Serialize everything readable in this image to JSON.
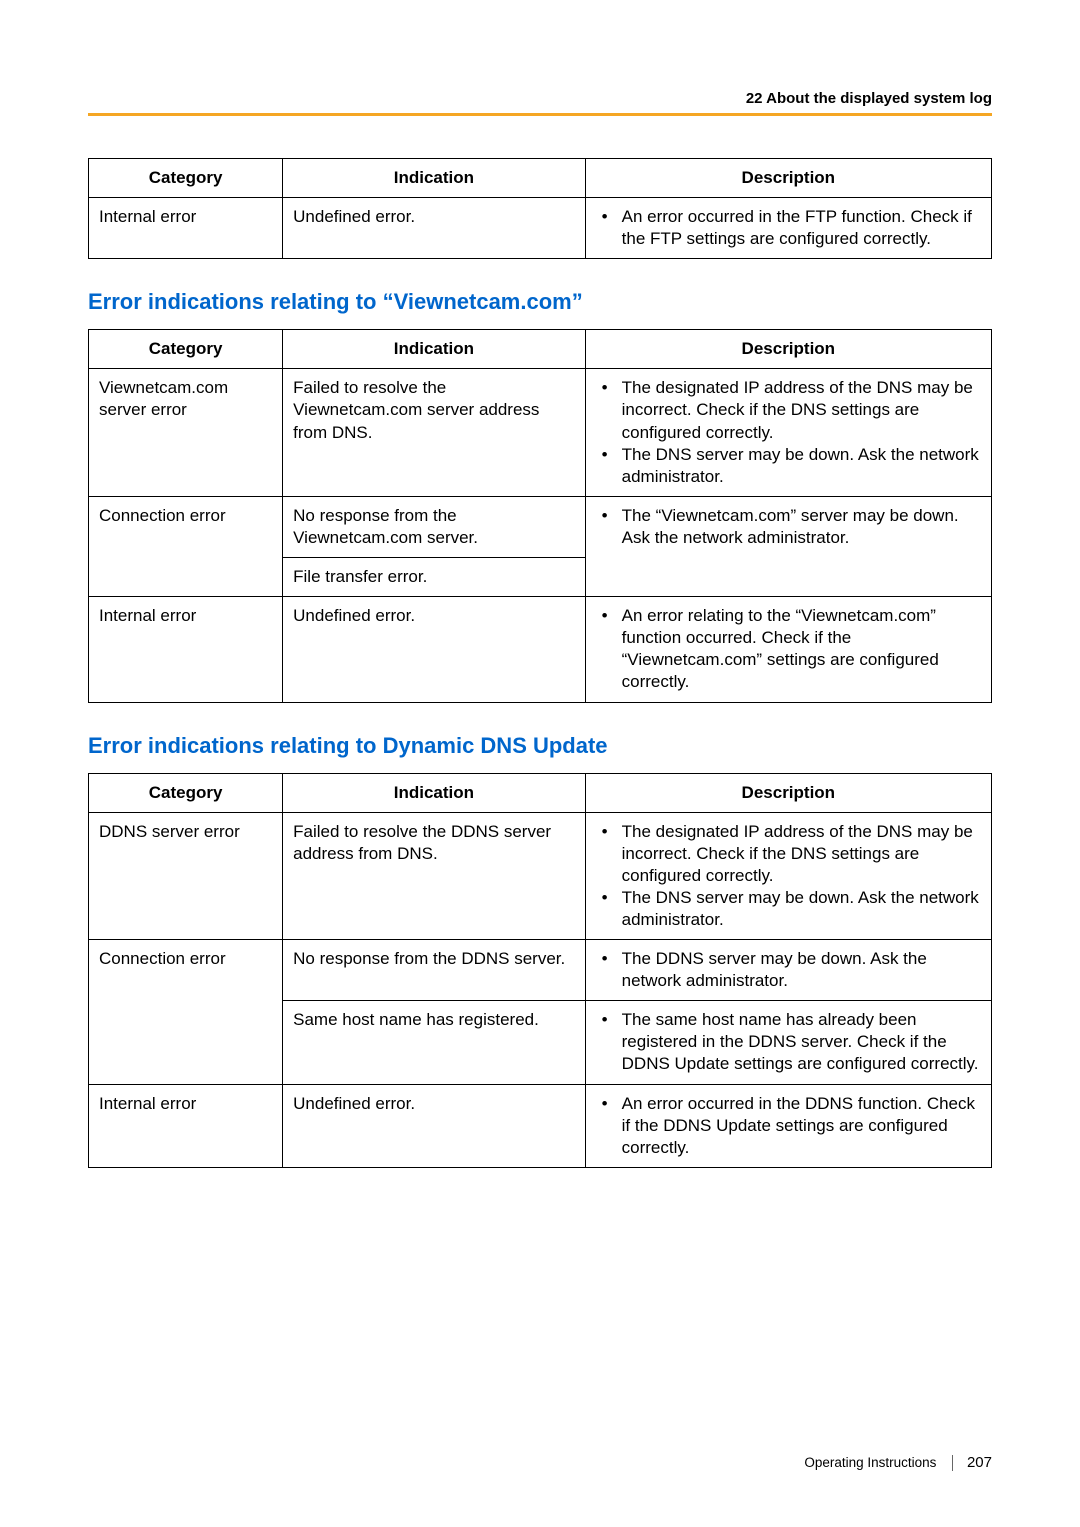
{
  "header": {
    "section_title": "22 About the displayed system log"
  },
  "table1": {
    "headers": {
      "c1": "Category",
      "c2": "Indication",
      "c3": "Description"
    },
    "rows": [
      {
        "category": "Internal error",
        "indication": "Undefined error.",
        "desc": [
          "An error occurred in the FTP function. Check if the FTP settings are configured correctly."
        ]
      }
    ]
  },
  "section2_title": "Error indications relating to “Viewnetcam.com”",
  "table2": {
    "headers": {
      "c1": "Category",
      "c2": "Indication",
      "c3": "Description"
    },
    "rows": [
      {
        "category": "Viewnetcam.com server error",
        "indication": "Failed to resolve the Viewnetcam.com server address from DNS.",
        "desc": [
          "The designated IP address of the DNS may be incorrect. Check if the DNS settings are configured correctly.",
          "The DNS server may be down. Ask the network administrator."
        ]
      },
      {
        "category": "Connection error",
        "ind1": "No response from the Viewnetcam.com server.",
        "ind2": "File transfer error.",
        "desc": [
          "The “Viewnetcam.com” server may be down. Ask the network administrator."
        ]
      },
      {
        "category": "Internal error",
        "indication": "Undefined error.",
        "desc": [
          "An error relating to the “Viewnetcam.com” function occurred. Check if the “Viewnetcam.com” settings are configured correctly."
        ]
      }
    ]
  },
  "section3_title": "Error indications relating to Dynamic DNS Update",
  "table3": {
    "headers": {
      "c1": "Category",
      "c2": "Indication",
      "c3": "Description"
    },
    "rows": [
      {
        "category": "DDNS server error",
        "indication": "Failed to resolve the DDNS server address from DNS.",
        "desc": [
          "The designated IP address of the DNS may be incorrect. Check if the DNS settings are configured correctly.",
          "The DNS server may be down. Ask the network administrator."
        ]
      },
      {
        "category": "Connection error",
        "ind1": "No response from the DDNS server.",
        "ind2": "Same host name has registered.",
        "desc1": [
          "The DDNS server may be down. Ask the network administrator."
        ],
        "desc2": [
          "The same host name has already been registered in the DDNS server. Check if the DDNS Update settings are configured correctly."
        ]
      },
      {
        "category": "Internal error",
        "indication": "Undefined error.",
        "desc": [
          "An error occurred in the DDNS function. Check if the DDNS Update settings are configured correctly."
        ]
      }
    ]
  },
  "footer": {
    "label": "Operating Instructions",
    "page": "207"
  }
}
